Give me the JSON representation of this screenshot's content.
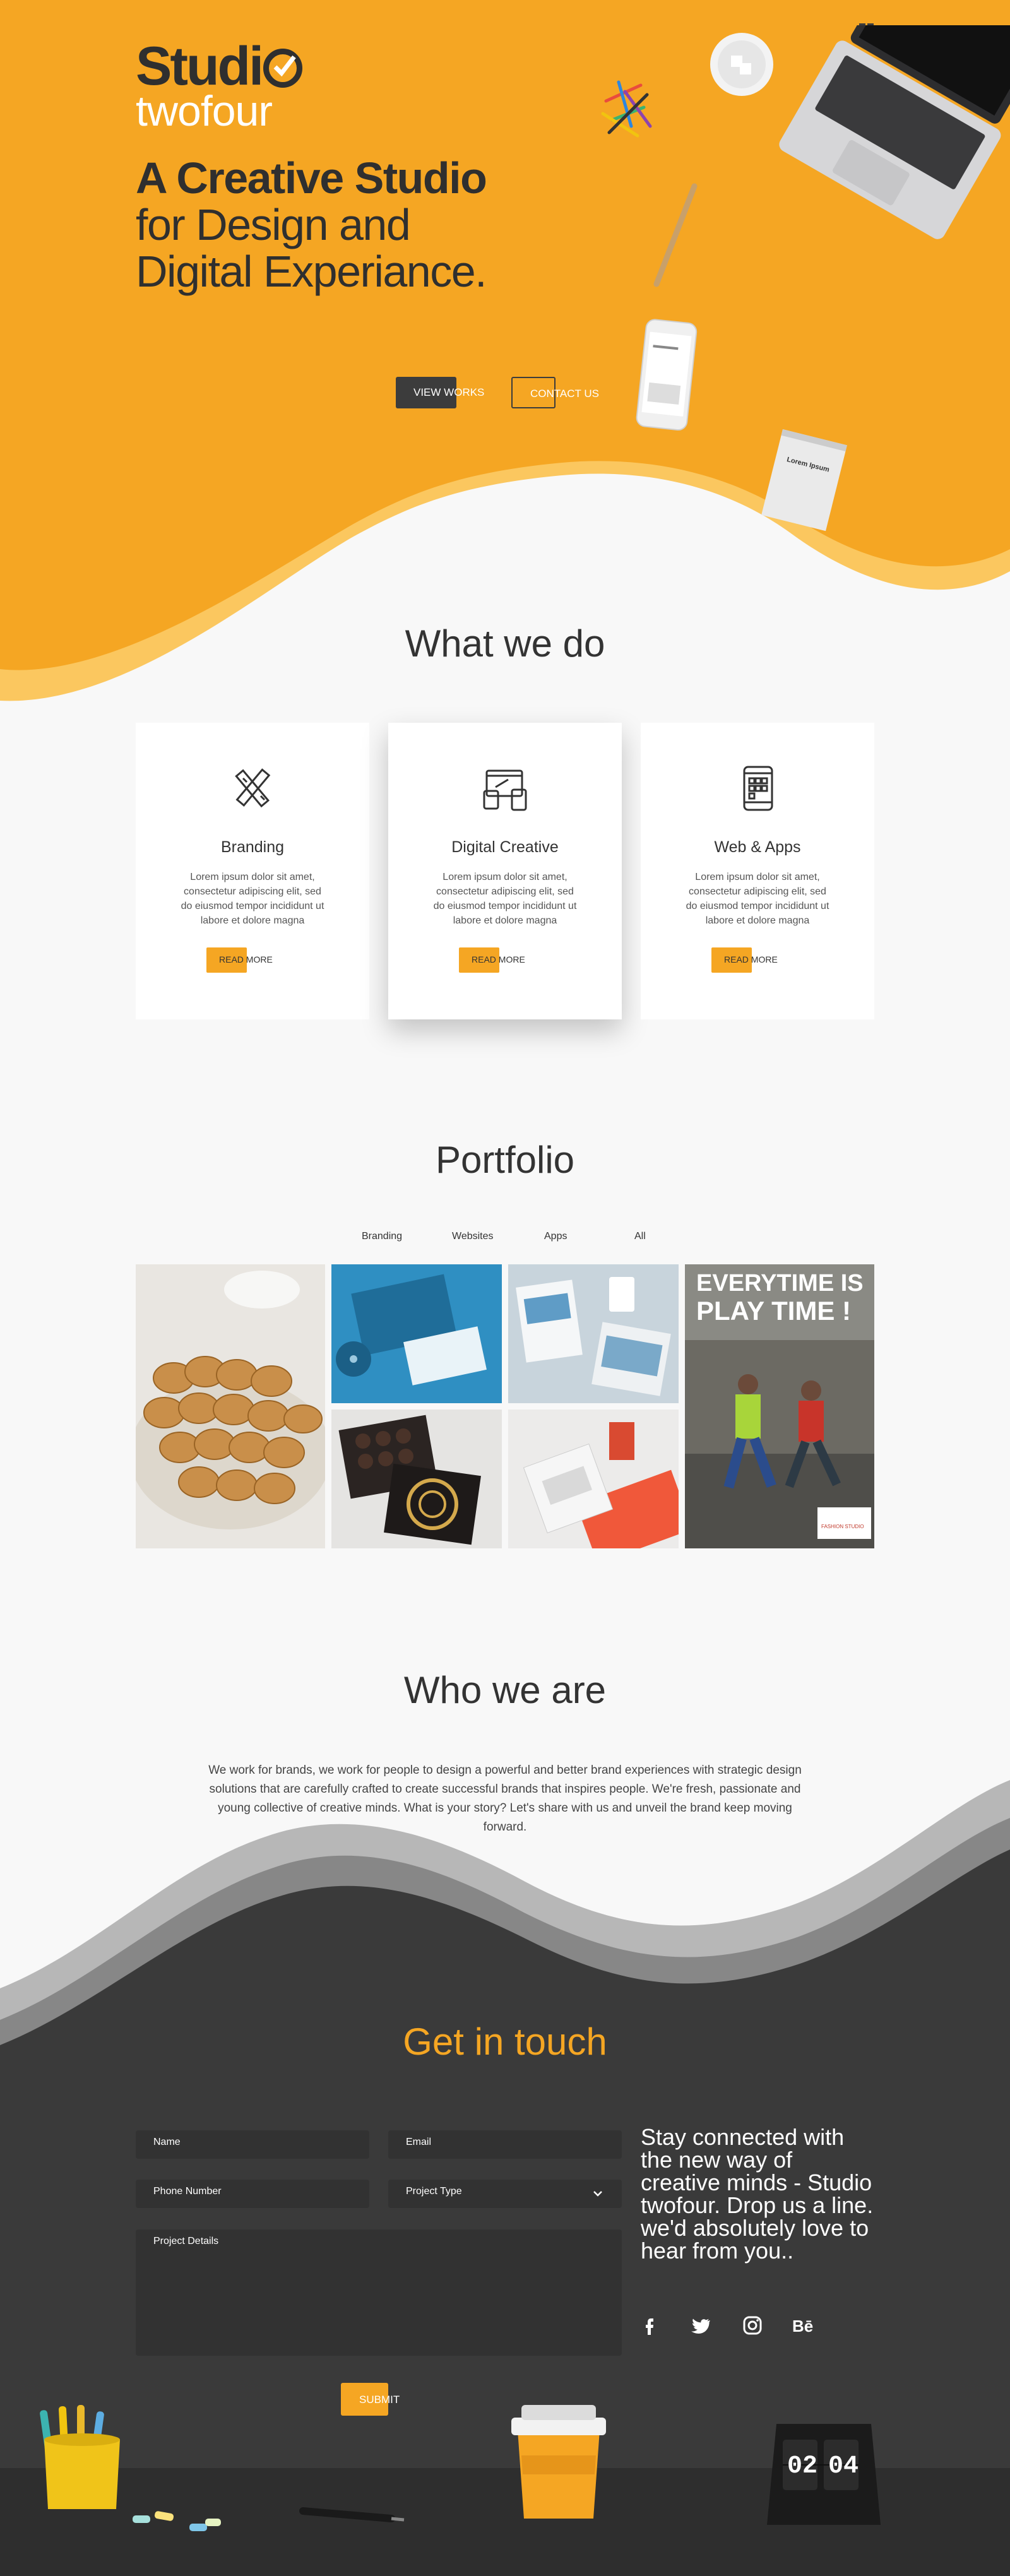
{
  "hero": {
    "logo_line1": "Studi",
    "logo_line2": "twofour",
    "headline_bold": "A Creative Studio",
    "headline_line2": "for Design and",
    "headline_line3": "Digital Experiance.",
    "view_works": "VIEW WORKS",
    "contact_us": "CONTACT US",
    "notepad_text": "Lorem Ipsum"
  },
  "colors": {
    "accent": "#f5a623",
    "dark": "#3c3c3c",
    "light_bg": "#f8f8f8"
  },
  "what_we_do": {
    "title": "What we do",
    "cards": [
      {
        "title": "Branding",
        "icon": "pencil-ruler-icon",
        "text": "Lorem ipsum dolor sit amet, consectetur adipiscing elit, sed do eiusmod tempor incididunt ut labore et dolore magna",
        "button": "READ MORE"
      },
      {
        "title": "Digital Creative",
        "icon": "devices-icon",
        "text": "Lorem ipsum dolor sit amet, consectetur adipiscing elit, sed do eiusmod tempor incididunt ut labore et dolore magna",
        "button": "READ MORE"
      },
      {
        "title": "Web & Apps",
        "icon": "mobile-app-icon",
        "text": "Lorem ipsum dolor sit amet, consectetur adipiscing elit, sed do eiusmod tempor incididunt ut labore et dolore magna",
        "button": "READ MORE"
      }
    ]
  },
  "portfolio": {
    "title": "Portfolio",
    "filters": [
      "Branding",
      "Websites",
      "Apps",
      "All"
    ],
    "poster_line1": "EVERYTIME IS",
    "poster_line2": "PLAY TIME !",
    "poster_brand": "FASHION STUDIO"
  },
  "who_we_are": {
    "title": "Who we are",
    "text": "We work for brands, we work for people to design a powerful and better brand experiences with strategic design solutions that are carefully crafted to create successful brands that inspires people. We're fresh, passionate and young collective of creative minds. What is your story? Let's share with us and unveil the brand keep moving forward."
  },
  "contact": {
    "title": "Get in touch",
    "name": "Name",
    "email": "Email",
    "phone": "Phone Number",
    "project_type": "Project Type",
    "project_details": "Project Details",
    "submit": "SUBMIT",
    "stay_text": "Stay connected with the new way of creative minds - Studio twofour. Drop us a line. we'd absolutely love to hear from you..",
    "social": [
      "facebook-icon",
      "twitter-icon",
      "instagram-icon",
      "behance-icon"
    ],
    "clock_hour": "02",
    "clock_minute": "04"
  }
}
